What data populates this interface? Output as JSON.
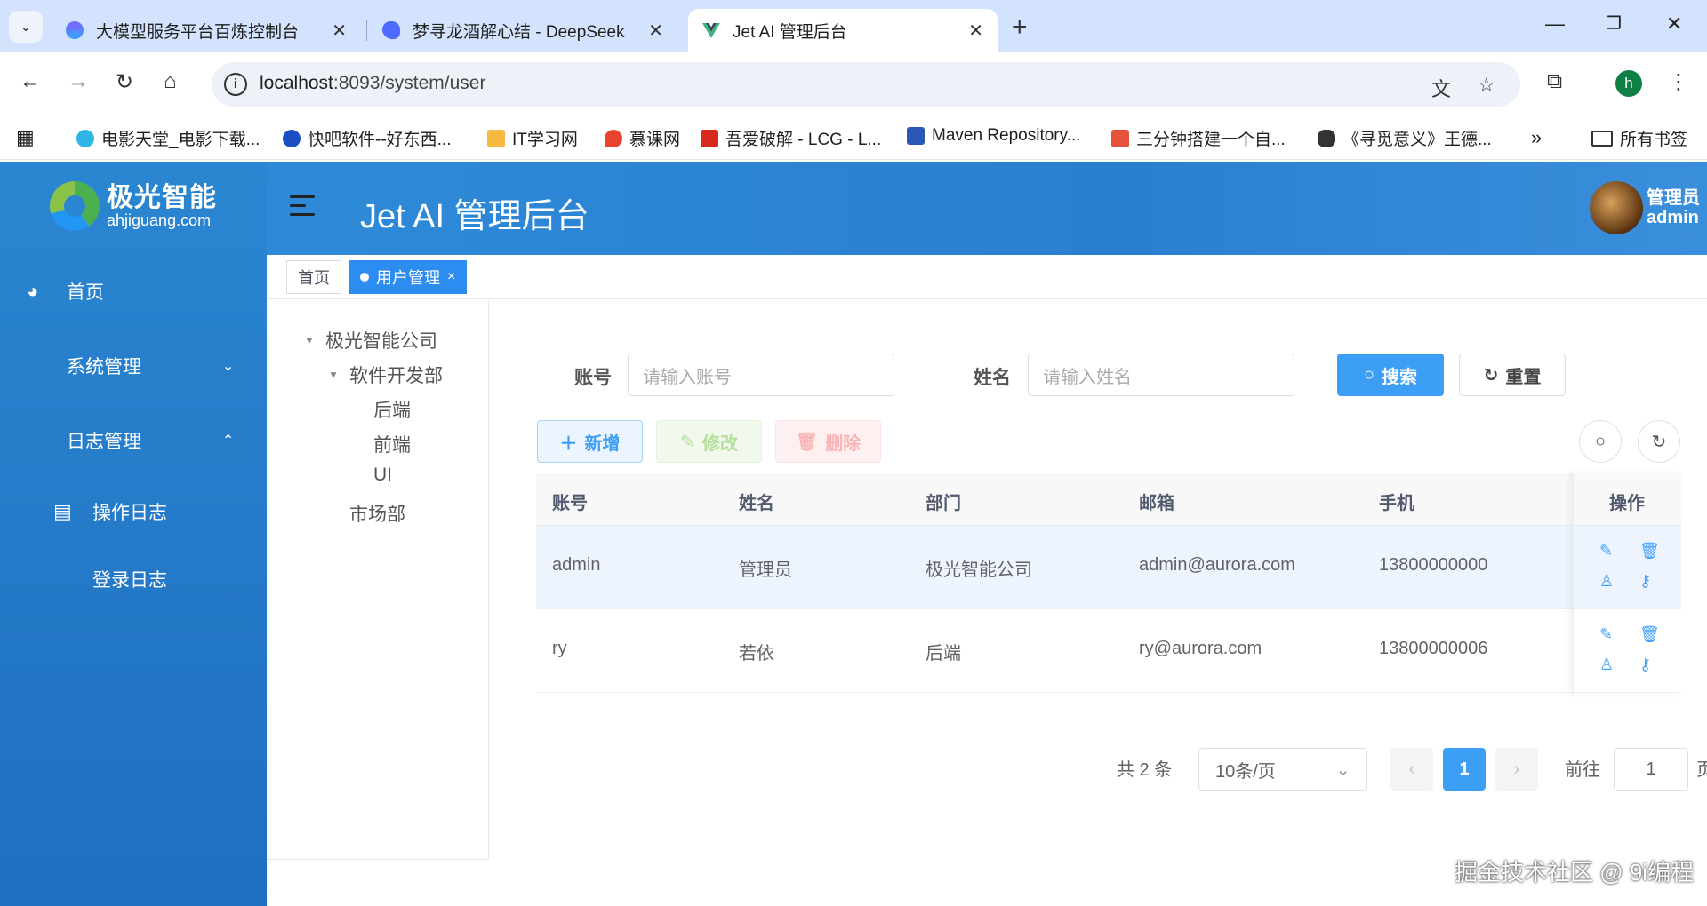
{
  "browser": {
    "tabs": [
      {
        "title": "大模型服务平台百炼控制台",
        "favicon_color": "#7b61ff"
      },
      {
        "title": "梦寻龙酒解心结 - DeepSeek",
        "favicon_color": "#4d6bfe"
      },
      {
        "title": "Jet AI 管理后台",
        "favicon_color": "#41b883"
      }
    ],
    "url_host": "localhost",
    "url_rest": ":8093/system/user",
    "profile_initial": "h",
    "bookmarks": [
      {
        "label": "电影天堂_电影下载...",
        "color": "#2fb6e8"
      },
      {
        "label": "快吧软件--好东西...",
        "color": "#1a4fc4"
      },
      {
        "label": "IT学习网",
        "color": "#f5b942"
      },
      {
        "label": "慕课网",
        "color": "#e8432e"
      },
      {
        "label": "吾爱破解 - LCG - L...",
        "color": "#d9281e"
      },
      {
        "label": "Maven Repository...",
        "color": "#2b57b5"
      },
      {
        "label": "三分钟搭建一个自...",
        "color": "#e5533d"
      },
      {
        "label": "《寻觅意义》王德...",
        "color": "#333333"
      }
    ],
    "more_bookmarks": "»",
    "all_bookmarks": "所有书签"
  },
  "app": {
    "logo_cn": "极光智能",
    "logo_en": "ahjiguang.com",
    "title": "Jet AI 管理后台",
    "user_role": "管理员",
    "user_name": "admin"
  },
  "sidebar": {
    "items": [
      {
        "label": "首页",
        "icon": "dashboard-icon"
      },
      {
        "label": "系统管理",
        "arrow": "⌄"
      },
      {
        "label": "日志管理",
        "arrow": "⌃"
      },
      {
        "label": "操作日志",
        "icon": "log-icon"
      },
      {
        "label": "登录日志"
      }
    ]
  },
  "tags": [
    {
      "label": "首页"
    },
    {
      "label": "用户管理",
      "close": "×"
    }
  ],
  "tree": {
    "root": "极光智能公司",
    "dept": "软件开发部",
    "children": [
      "后端",
      "前端",
      "UI"
    ],
    "market": "市场部"
  },
  "search": {
    "account_label": "账号",
    "account_placeholder": "请输入账号",
    "name_label": "姓名",
    "name_placeholder": "请输入姓名",
    "search_btn": "搜索",
    "reset_btn": "重置"
  },
  "actions": {
    "add": "新增",
    "edit": "修改",
    "delete": "删除"
  },
  "table": {
    "headers": [
      "账号",
      "姓名",
      "部门",
      "邮箱",
      "手机",
      "操作"
    ],
    "rows": [
      {
        "account": "admin",
        "name": "管理员",
        "dept": "极光智能公司",
        "email": "admin@aurora.com",
        "phone": "13800000000"
      },
      {
        "account": "ry",
        "name": "若依",
        "dept": "后端",
        "email": "ry@aurora.com",
        "phone": "13800000006"
      }
    ]
  },
  "pagination": {
    "total": "共 2 条",
    "page_size": "10条/页",
    "current": "1",
    "goto_label": "前往",
    "goto_value": "1",
    "page_suffix": "页"
  },
  "watermark": "掘金技术社区 @ 9i编程"
}
